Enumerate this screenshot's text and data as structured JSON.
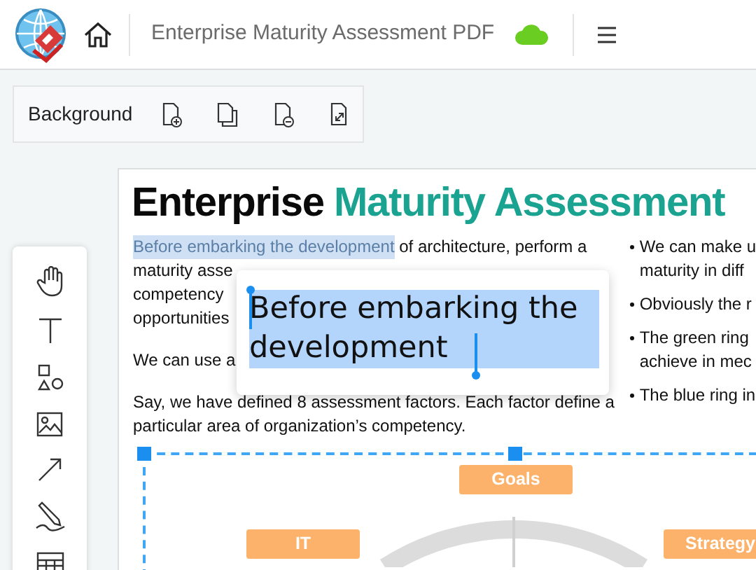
{
  "header": {
    "title": "Enterprise Maturity Assessment PDF"
  },
  "toolbar": {
    "label": "Background"
  },
  "document": {
    "title": [
      {
        "text": "Enterprise",
        "kind": "plain"
      },
      {
        "text": "Maturity Assessment",
        "kind": "accent"
      }
    ],
    "first_line": [
      {
        "text": "Before embarking the development",
        "selected": true
      },
      {
        "text": " of architecture, perform a",
        "selected": false
      }
    ],
    "fragments": [
      "maturity asse",
      "competency",
      "opportunities"
    ],
    "short_paragraph": "We can use a",
    "paragraph": "Say, we have defined 8 assessment factors. Each factor define a particular area of organization’s competency.",
    "bullets": [
      {
        "lines": [
          "We can make u",
          "maturity in diff"
        ]
      },
      {
        "lines": [
          "Obviously the r"
        ]
      },
      {
        "lines": [
          "The green ring",
          "achieve in mec"
        ]
      },
      {
        "lines": [
          "The blue ring in"
        ]
      }
    ],
    "editor_popup": {
      "value": "Before embarking the development"
    },
    "diagram": {
      "labels": [
        "Goals",
        "IT",
        "Strategy"
      ]
    }
  }
}
